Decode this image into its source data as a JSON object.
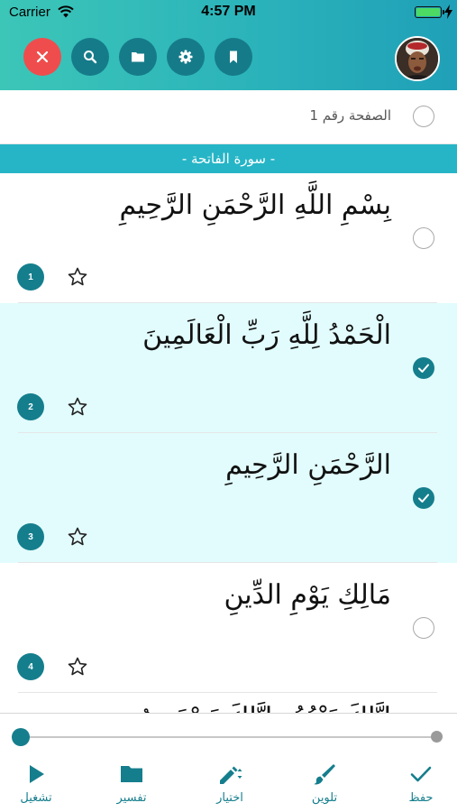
{
  "status_bar": {
    "carrier": "Carrier",
    "time": "4:57 PM",
    "battery_level": 1.0
  },
  "toolbar": {
    "buttons": [
      {
        "name": "close",
        "icon": "close-icon",
        "color": "#ef4d4d"
      },
      {
        "name": "search",
        "icon": "search-icon",
        "color": "#167b89"
      },
      {
        "name": "folder",
        "icon": "folder-icon",
        "color": "#167b89"
      },
      {
        "name": "settings",
        "icon": "gear-icon",
        "color": "#167b89"
      },
      {
        "name": "bookmark",
        "icon": "bookmark-icon",
        "color": "#167b89"
      }
    ],
    "avatar_icon": "reciter-avatar"
  },
  "page_row": {
    "label": "الصفحة رقم 1",
    "selected": false
  },
  "surah_header": {
    "title": "- سورة الفاتحة -"
  },
  "verses": [
    {
      "number": "1",
      "text": "بِسْمِ اللَّهِ الرَّحْمَنِ الرَّحِيمِ",
      "selected": false
    },
    {
      "number": "2",
      "text": "الْحَمْدُ لِلَّهِ رَبِّ الْعَالَمِينَ",
      "selected": true
    },
    {
      "number": "3",
      "text": "الرَّحْمَنِ الرَّحِيمِ",
      "selected": true
    },
    {
      "number": "4",
      "text": "مَالِكِ يَوْمِ الدِّينِ",
      "selected": false
    }
  ],
  "partial_verse": {
    "text": "إِيَّاكَ نَعْبُدُ وَإِيَّاكَ نَسْتَعِينُ"
  },
  "playback": {
    "progress": 0.0
  },
  "bottom_tabs": {
    "play": {
      "label": "تشغيل",
      "icon": "play-icon"
    },
    "tafsir": {
      "label": "تفسير",
      "icon": "folder-icon"
    },
    "select": {
      "label": "اختيار",
      "icon": "pencil-sort-icon"
    },
    "color": {
      "label": "تلوين",
      "icon": "brush-icon"
    },
    "save": {
      "label": "حفظ",
      "icon": "check-icon"
    }
  },
  "colors": {
    "accent": "#157e8d",
    "header_start": "#3cc6b8",
    "header_end": "#1fa0b8",
    "surah_bar": "#26b5c6",
    "selected_row": "#e2fcfd",
    "close": "#ef4d4d"
  }
}
